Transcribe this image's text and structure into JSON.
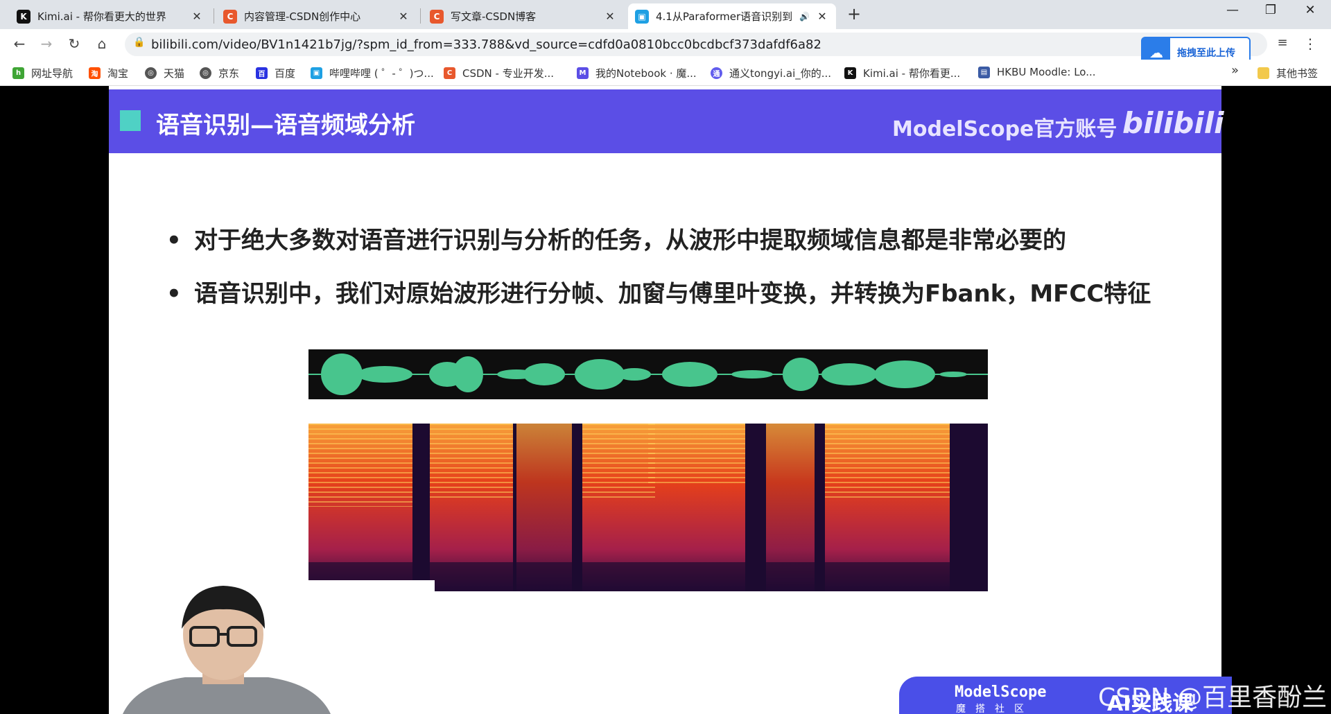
{
  "tabs": [
    {
      "title": "Kimi.ai - 帮你看更大的世界",
      "icon": "kimi-icon",
      "color": "#111111",
      "glyph": "K"
    },
    {
      "title": "内容管理-CSDN创作中心",
      "icon": "csdn-icon",
      "color": "#e8582d",
      "glyph": "C"
    },
    {
      "title": "写文章-CSDN博客",
      "icon": "csdn-icon",
      "color": "#e8582d",
      "glyph": "C"
    },
    {
      "title": "4.1从Paraformer语音识别到",
      "icon": "bilibili-tv-icon",
      "color": "#1ea0e3",
      "glyph": "▣",
      "active": true
    }
  ],
  "tab_close": "✕",
  "new_tab": "+",
  "window": {
    "minimize": "—",
    "restore": "❐",
    "close": "✕"
  },
  "nav": {
    "back": "←",
    "forward": "→",
    "reload": "↻",
    "home": "⌂"
  },
  "address": {
    "url": "bilibili.com/video/BV1n1421b7jg/?spm_id_from=333.788&vd_source=cdfd0a0810bcc0bcdbcf373dafdf6a82"
  },
  "baidu_popup": {
    "label": "拖拽至此上传"
  },
  "bookmarks": [
    {
      "label": "网址导航",
      "icon": "hao123-icon",
      "color": "#3fa535"
    },
    {
      "label": "淘宝",
      "icon": "taobao-icon",
      "color": "#ff5000"
    },
    {
      "label": "天猫",
      "icon": "globe-icon",
      "color": "#555555"
    },
    {
      "label": "京东",
      "icon": "globe-icon",
      "color": "#555555"
    },
    {
      "label": "百度",
      "icon": "baidu-icon",
      "color": "#2932e1"
    },
    {
      "label": "哔哩哔哩 ( ゜- ゜)つ...",
      "icon": "bilibili-icon",
      "color": "#1ea0e3"
    },
    {
      "label": "CSDN - 专业开发...",
      "icon": "csdn-icon",
      "color": "#e8582d"
    },
    {
      "label": "我的Notebook · 魔...",
      "icon": "modelscope-icon",
      "color": "#5b4ee6"
    },
    {
      "label": "通义tongyi.ai_你的...",
      "icon": "tongyi-icon",
      "color": "#615ced"
    },
    {
      "label": "Kimi.ai - 帮你看更...",
      "icon": "kimi-icon",
      "color": "#111111"
    },
    {
      "label": "HKBU Moodle: Lo...",
      "icon": "moodle-icon",
      "color": "#3b5ba5"
    }
  ],
  "bookmarks_overflow": "»",
  "other_bookmarks": "其他书签",
  "slide": {
    "title": "语音识别—语音频域分析",
    "brand": "ModelScope官方账号",
    "brand_logo": "bilibili",
    "bullets": [
      "对于绝大多数对语音进行识别与分析的任务，从波形中提取频域信息都是非常必要的",
      "语音识别中，我们对原始波形进行分帧、加窗与傅里叶变换，并转换为Fbank，MFCC特征"
    ],
    "bullet_symbol": "•"
  },
  "banner": {
    "logo": "ModelScope",
    "sub": "魔搭社区",
    "course": "AI实践课"
  },
  "watermark": "CSDN @百里香酚兰"
}
